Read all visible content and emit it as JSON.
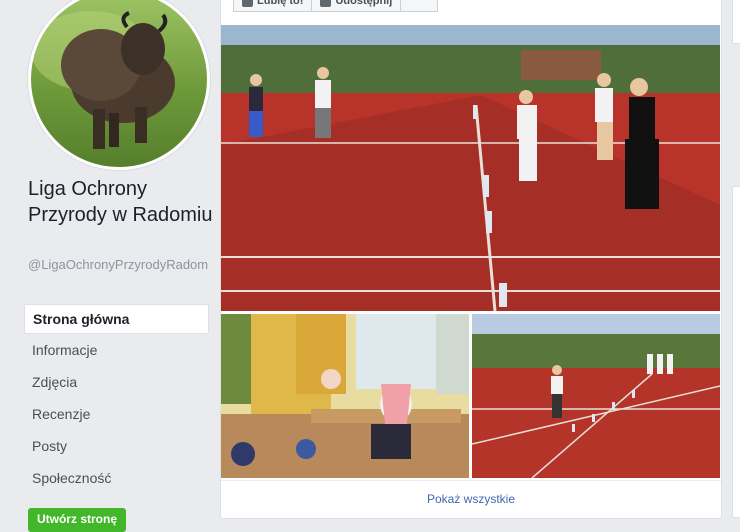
{
  "page": {
    "name": "Liga Ochrony Przyrody w Radomiu",
    "handle": "@LigaOchronyPrzyrodyRadom"
  },
  "nav": {
    "items": [
      {
        "label": "Strona główna",
        "active": true
      },
      {
        "label": "Informacje"
      },
      {
        "label": "Zdjęcia"
      },
      {
        "label": "Recenzje"
      },
      {
        "label": "Posty"
      },
      {
        "label": "Społeczność"
      }
    ],
    "create_button": "Utwórz stronę"
  },
  "toolbar": {
    "like_label": "Lubię to!",
    "share_label": "Udostępnij"
  },
  "photos": {
    "show_all": "Pokaż wszystkie"
  },
  "colors": {
    "link": "#4267b2",
    "cta": "#42b72a",
    "court": "#b8342a"
  }
}
